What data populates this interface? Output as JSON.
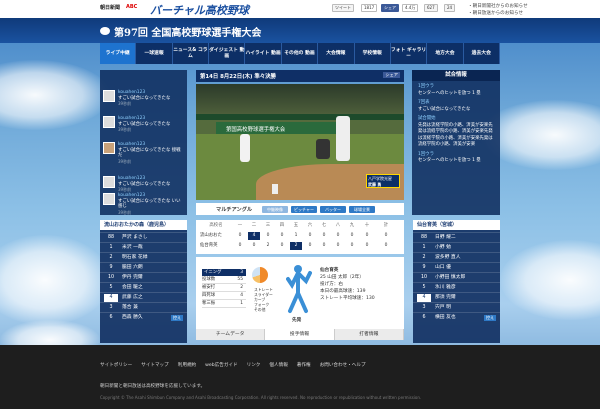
{
  "header": {
    "asahi": "朝日新聞",
    "abc": "ABC",
    "site_title": "バーチャル高校野球",
    "share": {
      "tweet": "ツイート",
      "tweet_count": "1817",
      "like": "シェア",
      "like_count": "4.4万",
      "g1": "627",
      "g2": "24"
    },
    "notices": [
      "・朝日新聞社からのお知らせ",
      "・朝日放送からのお知らせ"
    ]
  },
  "banner": {
    "title": "第97回 全国高校野球選手権大会"
  },
  "nav": [
    {
      "label": "ライブ中継"
    },
    {
      "label": "一球速報"
    },
    {
      "label": "ニュース& コラム"
    },
    {
      "label": "ダイジェスト 動画"
    },
    {
      "label": "ハイライト 動画"
    },
    {
      "label": "その他の 動画"
    },
    {
      "label": "大会情報"
    },
    {
      "label": "学校情報"
    },
    {
      "label": "フォト ギャラリー"
    },
    {
      "label": "地方大会"
    },
    {
      "label": "過去大会"
    }
  ],
  "chat": [
    {
      "name": "kouahen123",
      "text": "すごい試合になってきたな",
      "age": "39秒前"
    },
    {
      "name": "kouahen123",
      "text": "すごい試合になってきたな",
      "age": "39秒前"
    },
    {
      "name": "kouahen123",
      "text": "すごい試合になってきたな 接戦だ",
      "age": "39秒前"
    },
    {
      "name": "kouahen123",
      "text": "すごい試合になってきたな",
      "age": "39秒前"
    },
    {
      "name": "kouahen123",
      "text": "すごい試合になってきたな いい感じ",
      "age": "39秒前"
    }
  ],
  "game": {
    "title": "第14日 8月22日(木) 準々決勝",
    "fb": "シェア",
    "multi": "マルチアングル",
    "angles": [
      "中継映像",
      "ピッチャー",
      "バッター",
      "球場全景"
    ]
  },
  "video": {
    "board_title": "第国高校野球選手権大会",
    "tv_line": "八戸学院光星",
    "tv_name": "武藤 勇"
  },
  "commentary": {
    "title": "試合情報",
    "items": [
      "1回ウラ",
      "センターへのヒットを放つ 1 塁",
      "7回表",
      "すごい試合になってきたな",
      "試合開始",
      "先発は流経学院の小路、済美が安楽先発は流経学院の小路、済美が安楽先発は流経学院の小路、済美が安楽先発は流経学院の小路、済美が安楽",
      "1回ウラ",
      "センターへのヒットを放つ 1 塁"
    ]
  },
  "left_team": {
    "name": "流山おおたかの森（鹿児島）",
    "players": [
      {
        "no": "88",
        "name": "芦沢 まさし"
      },
      {
        "no": "1",
        "name": "米沢 一哉"
      },
      {
        "no": "2",
        "name": "明石家 花緑"
      },
      {
        "no": "9",
        "name": "脇田 六朗"
      },
      {
        "no": "10",
        "name": "伊丹 完爾"
      },
      {
        "no": "5",
        "name": "会田 暖之"
      },
      {
        "no": "4",
        "name": "武藤 広之"
      },
      {
        "no": "3",
        "name": "落合 兼"
      },
      {
        "no": "6",
        "name": "西森 勝久"
      }
    ],
    "more": "控え"
  },
  "right_team": {
    "name": "仙台育英（宮城）",
    "players": [
      {
        "no": "88",
        "name": "日野 耀二"
      },
      {
        "no": "1",
        "name": "小野 勉"
      },
      {
        "no": "2",
        "name": "波多野 直人"
      },
      {
        "no": "9",
        "name": "山口 優"
      },
      {
        "no": "10",
        "name": "小野田 慎太郎"
      },
      {
        "no": "5",
        "name": "氷川 雅彦"
      },
      {
        "no": "4",
        "name": "那須 完爾"
      },
      {
        "no": "3",
        "name": "宍戸 明"
      },
      {
        "no": "6",
        "name": "横田 友也"
      }
    ],
    "more": "控え"
  },
  "scoreboard": {
    "head": [
      "高校名",
      "一",
      "二",
      "三",
      "四",
      "五",
      "六",
      "七",
      "八",
      "九",
      "十",
      "計"
    ],
    "rows": [
      {
        "team": "流山おおた",
        "runs": [
          "0",
          "4",
          "0",
          "0",
          "1",
          "0",
          "0",
          "0",
          "0",
          "0",
          "0"
        ]
      },
      {
        "team": "仙台育英",
        "runs": [
          "0",
          "0",
          "2",
          "0",
          "2",
          "0",
          "0",
          "0",
          "0",
          "0",
          "0"
        ]
      }
    ]
  },
  "detail": {
    "stat_head": [
      "イニング",
      "3"
    ],
    "stats": [
      [
        "投球数",
        "55"
      ],
      [
        "被安打",
        "2"
      ],
      [
        "四死球",
        "4"
      ],
      [
        "奪三振",
        "1"
      ]
    ],
    "pie_legend": [
      "ストレート",
      "スライダー",
      "カーブ",
      "フォーク",
      "その他"
    ],
    "pitcher_label": "先発",
    "player": {
      "team": "仙台育英",
      "no_name": "25 山田 太郎（2年）",
      "hand": "投げ方：右",
      "lines": [
        "本日の最高球速：139",
        "ストレート平均球速：130"
      ]
    }
  },
  "tabs": [
    "チームデータ",
    "投手情報",
    "打者情報"
  ],
  "footer": {
    "links": [
      "サイトポリシー",
      "サイトマップ",
      "利用規約",
      "web広告ガイド",
      "リンク",
      "個人情報",
      "著作権",
      "お問い合わせ・ヘルプ"
    ],
    "line1": "朝日新聞と朝日放送は高校野球を応援しています。",
    "copyright": "Copyright © The Asahi Shimbun Company and Asahi Broadcasting Corporation. All rights reserved. No reproduction or republication without written permission."
  },
  "colors": {
    "nav_bg": "#0d2f66",
    "accent": "#1e73cf",
    "panel": "#0f2d5f"
  }
}
